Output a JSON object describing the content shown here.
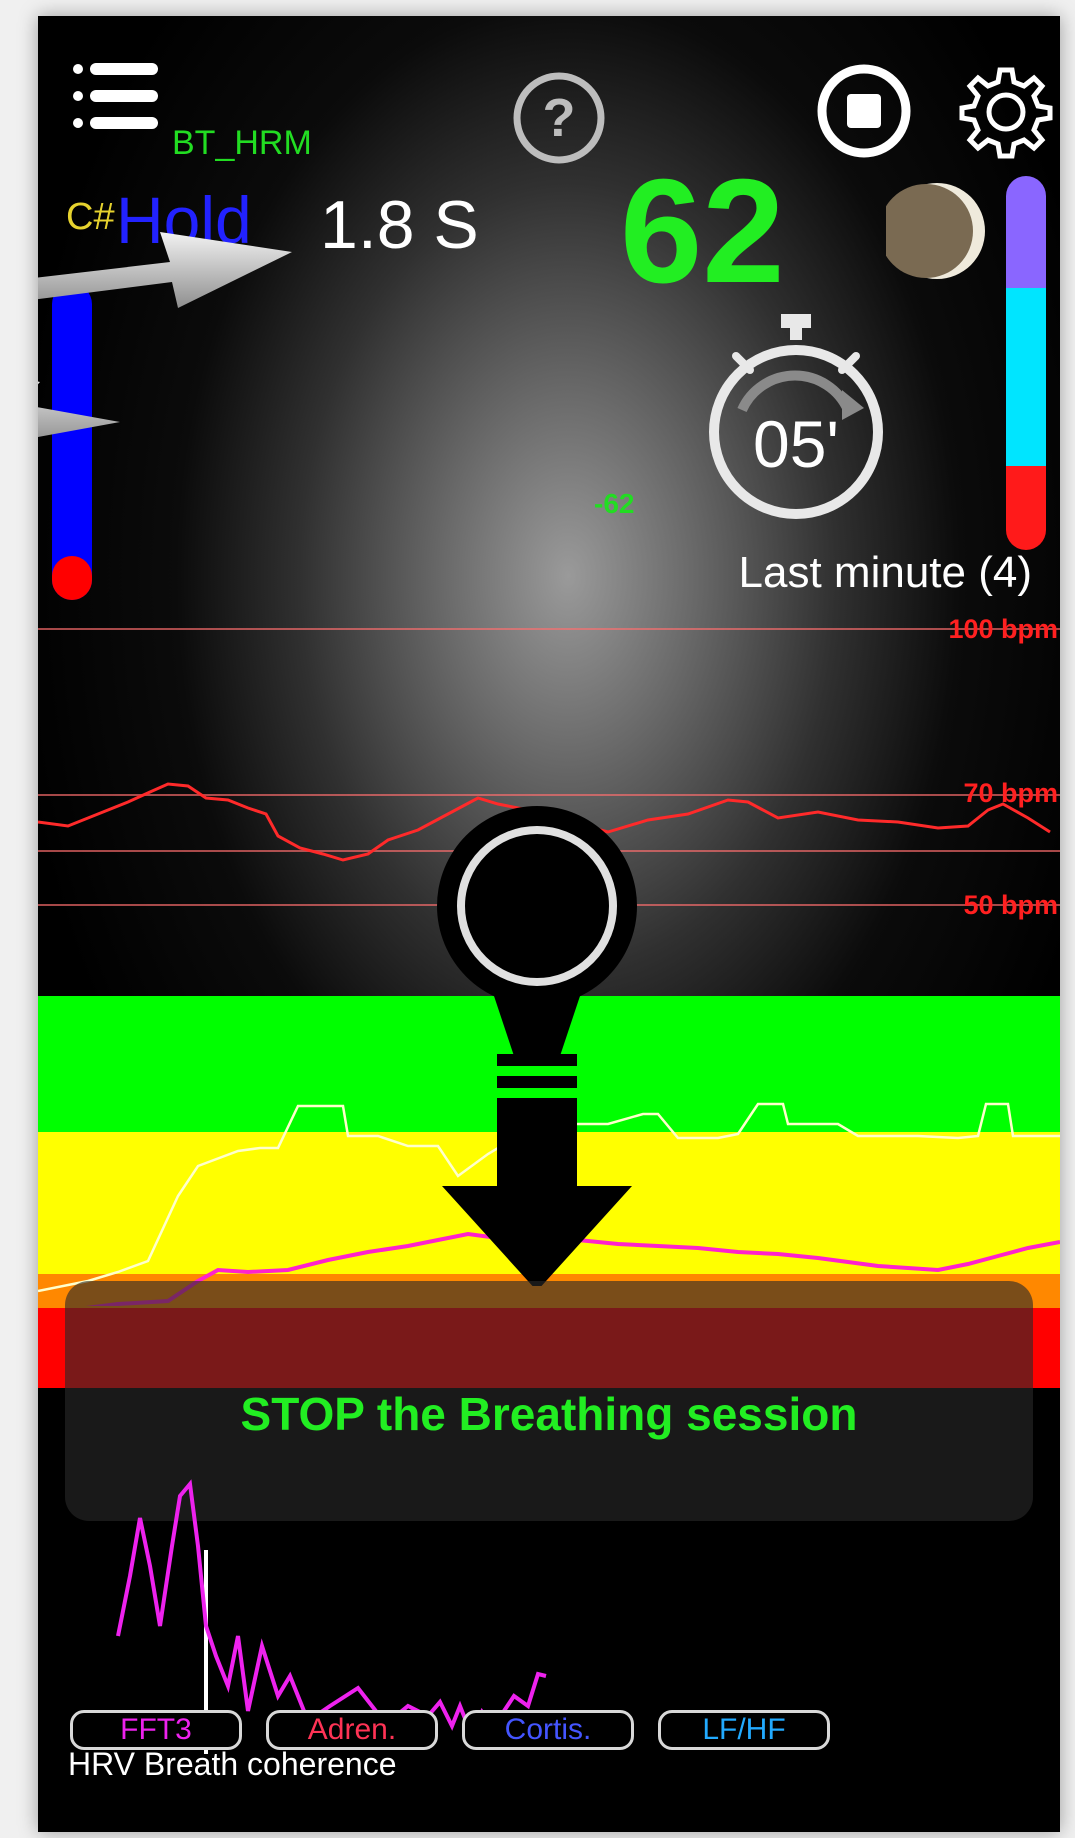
{
  "header": {
    "menu_icon": "hamburger-menu-icon",
    "help_icon": "question-mark-icon",
    "stop_icon": "stop-icon",
    "settings_icon": "gear-icon",
    "device_name": "BT_HRM",
    "device_color": "#22dd22"
  },
  "breath": {
    "note": "C#",
    "phase": "Hold",
    "duration": "1.8 S",
    "level_bar_fill": 0.1
  },
  "heart_rate": {
    "value": "62",
    "delta": "-62",
    "color": "#22ee22"
  },
  "moon_icon": "moon-phase-icon",
  "timer": {
    "icon": "stopwatch-icon",
    "label": "05'"
  },
  "right_gauge": {
    "segments": [
      "#8a66ff",
      "#00e5ff",
      "#ff1a1a"
    ]
  },
  "last_minute_label": "Last minute (4)",
  "chart_labels": {
    "upper": "100 bpm",
    "middle": "70 bpm",
    "lower": "50 bpm"
  },
  "breath_indicator_icon": "breath-exhale-arrow-icon",
  "stop_button_label": "STOP the Breathing session",
  "coherence_label": "HRV Breath coherence",
  "tabs": [
    {
      "label": "FFT3",
      "color": "#ee22ee"
    },
    {
      "label": "Adren.",
      "color": "#ff3355"
    },
    {
      "label": "Cortis.",
      "color": "#4455ff"
    },
    {
      "label": "LF/HF",
      "color": "#22aaff"
    }
  ]
}
